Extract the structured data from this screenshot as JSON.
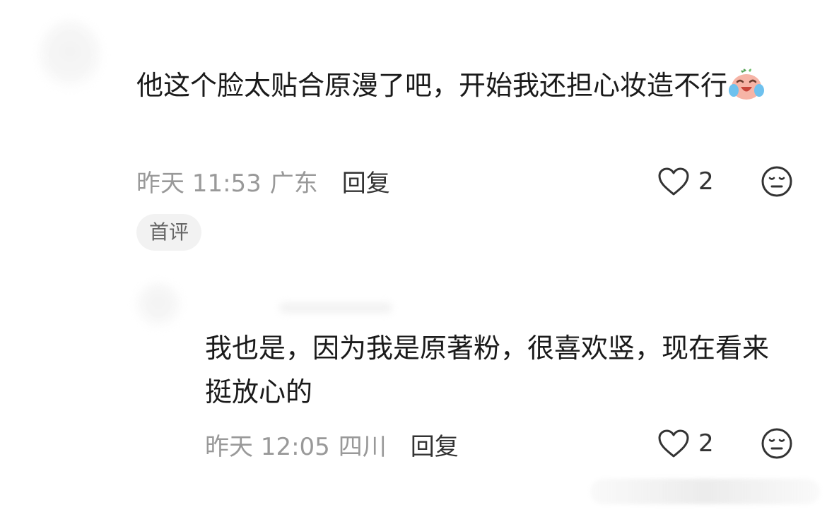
{
  "comments": {
    "main": {
      "text": "他这个脸太贴合原漫了吧，开始我还担心妆造不行",
      "emoji_icon": "laugh-crying-emoji-icon",
      "time": "昨天 11:53",
      "location": "广东",
      "reply_label": "回复",
      "like_count": "2",
      "badge": "首评"
    },
    "reply": {
      "text": "我也是，因为我是原著粉，很喜欢竖，现在看来挺放心的",
      "time": "昨天 12:05",
      "location": "四川",
      "reply_label": "回复",
      "like_count": "2"
    }
  },
  "icons": {
    "like": "heart-outline-icon",
    "dislike": "meh-face-icon"
  },
  "colors": {
    "text_primary": "#1a1a1a",
    "meta_gray": "#999999",
    "badge_bg": "#f2f2f2"
  }
}
